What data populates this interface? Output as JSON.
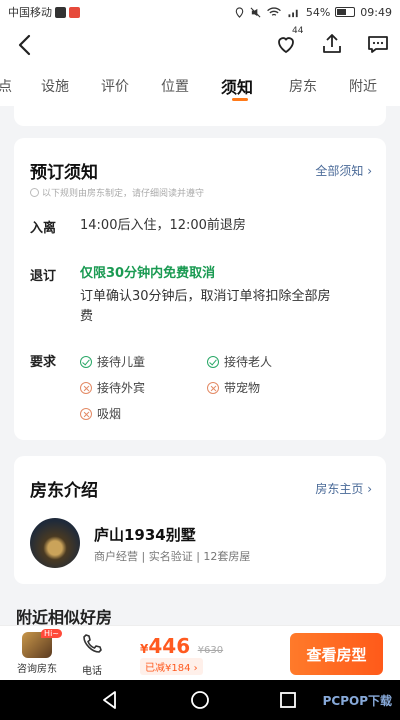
{
  "status_bar": {
    "carrier": "中国移动",
    "battery": "54%",
    "time": "09:49"
  },
  "nav": {
    "favorite_count": "44"
  },
  "tabs": [
    {
      "label": "点"
    },
    {
      "label": "设施"
    },
    {
      "label": "评价"
    },
    {
      "label": "位置"
    },
    {
      "label": "须知",
      "active": true
    },
    {
      "label": "房东"
    },
    {
      "label": "附近"
    }
  ],
  "booking_rules": {
    "title": "预订须知",
    "all_link": "全部须知 ›",
    "note": "以下规则由房东制定，请仔细阅读并遵守",
    "checkin_label": "入离",
    "checkin_text": "14:00后入住，12:00前退房",
    "cancel_label": "退订",
    "cancel_highlight": "仅限30分钟内免费取消",
    "cancel_line1": "订单确认30分钟后，取消订单将扣除全部房",
    "cancel_line2": "费",
    "requirements_label": "要求",
    "requirements": [
      {
        "text": "接待儿童",
        "allowed": true
      },
      {
        "text": "接待老人",
        "allowed": true
      },
      {
        "text": "接待外宾",
        "allowed": false
      },
      {
        "text": "带宠物",
        "allowed": false
      },
      {
        "text": "吸烟",
        "allowed": false
      }
    ]
  },
  "host": {
    "title": "房东介绍",
    "home_link": "房东主页 ›",
    "name": "庐山1934别墅",
    "meta": "商户经营 | 实名验证 | 12套房屋"
  },
  "next_section_title": "附近相似好房",
  "bottom_bar": {
    "consult_label": "咨询房东",
    "consult_badge": "Hi~",
    "phone_label": "电话",
    "currency": "¥",
    "price": "446",
    "original_price": "¥630",
    "discount": "已减¥184 ›",
    "book_button": "查看房型"
  },
  "watermark": "PCPOP下载",
  "colors": {
    "accent": "#ff5a1f",
    "green": "#1a9a52",
    "link": "#4a6a98"
  }
}
